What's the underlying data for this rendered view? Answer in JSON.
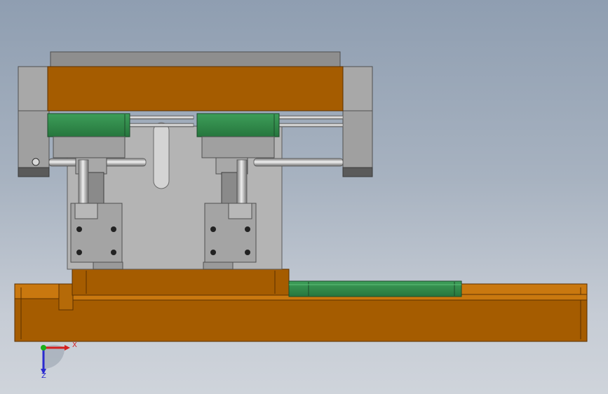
{
  "viewport": {
    "background_top": "#8f9eb1",
    "background_bottom": "#cfd4db"
  },
  "colors": {
    "orange_body": "#a55c00",
    "orange_light": "#c9780f",
    "green_block": "#2f8a4a",
    "steel_gray": "#a9a9a9",
    "dark_gray": "#5a5a5a"
  },
  "triad": {
    "x_label": "X",
    "z_label": "Z",
    "x_color": "#d42020",
    "y_color": "#19b019",
    "z_color": "#2a2ad0"
  }
}
